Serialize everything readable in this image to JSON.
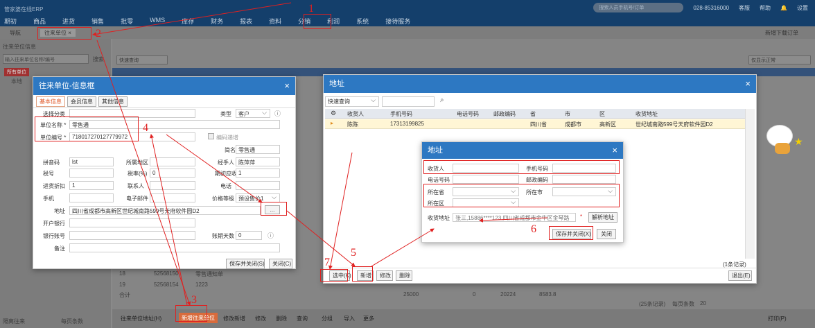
{
  "app": {
    "logo_text": "管家婆在线ERP",
    "phone": "028-85316000",
    "help": "客服",
    "user": "帮助",
    "settings": "设置",
    "search_placeholder": "搜索人员手机号/订单"
  },
  "nav": {
    "items": [
      "期初",
      "商品",
      "进货",
      "销售",
      "批零",
      "WMS",
      "库存",
      "财务",
      "报表",
      "资料",
      "分销",
      "利润",
      "系统",
      "接待服务"
    ]
  },
  "tabs": {
    "nav_label": "导航",
    "active_tab": "往来单位",
    "tab_close": "×",
    "right_link": "新增下载订单"
  },
  "left": {
    "title": "往来单位信息",
    "search_placeholder": "输入往来单位名称/编号",
    "search_btn": "搜索",
    "tree_all": "所有单位",
    "tree_child": "本地"
  },
  "main": {
    "quick_query": "快速查询",
    "bottom_total": "合计",
    "status_right": "仅显示正常",
    "rows": [
      {
        "no": "18",
        "code": "52568150",
        "name": "零售通知单"
      },
      {
        "no": "19",
        "code": "52568154",
        "name": "1223"
      }
    ],
    "totals": [
      "25000",
      "0",
      "20224",
      "8583.8"
    ],
    "paging": "(25条记录)",
    "per_page": "每页条数",
    "page_size": "20"
  },
  "bottom": {
    "buttons": [
      "往来单位地址(H)",
      "新增往来单位",
      "修改新增",
      "修改",
      "删除",
      "查询",
      "分组",
      "导入",
      "更多"
    ],
    "left_label": "隔离往来",
    "left_count": "每页条数",
    "print": "打印(P)"
  },
  "info_dialog": {
    "title": "往来单位-信息框",
    "close": "×",
    "tabs": [
      "基本信息",
      "会员信息",
      "其他信息"
    ],
    "fields": {
      "category_label": "选择分类",
      "type_label": "类型",
      "type_value": "客户",
      "name_label": "单位名称 *",
      "name_value": "零售通",
      "code_label": "单位编号 *",
      "code_value": "718017270127779972",
      "check_label": "编码递增",
      "short_label": "简名",
      "short_value": "零售通",
      "pinyin_label": "拼音码",
      "pinyin_value": "lst",
      "region_label": "所属地区",
      "manager_label": "经手人",
      "manager_value": "陈萍萍",
      "tax_label": "税号",
      "tax_rate_label": "税率(%)",
      "tax_rate_value": "0",
      "receivable_label": "期初应收",
      "receivable_value": "1",
      "advance_label": "进货折扣",
      "advance_value": "1",
      "contact_label": "联系人",
      "phone_label": "电话",
      "mobile_label": "手机",
      "email_label": "电子邮件",
      "price_label": "价格等级",
      "price_value": "预设售价1",
      "address_label": "地址",
      "address_value": "四川省成都市高新区世纪城南路599号天府软件园D2",
      "address_btn": "...",
      "bank_label": "开户银行",
      "account_label": "银行账号",
      "days_label": "账期天数",
      "days_value": "0",
      "note_label": "备注"
    },
    "save_btn": "保存并关闭(S)",
    "close_btn": "关闭(C)"
  },
  "addr_dialog": {
    "title": "地址",
    "close": "×",
    "quick_query": "快速查询",
    "columns": [
      "收货人",
      "手机号码",
      "电话号码",
      "邮政编码",
      "省",
      "市",
      "区",
      "收货地址"
    ],
    "row": {
      "receiver": "陈陈",
      "mobile": "17313199825",
      "phone": "",
      "zip": "",
      "province": "四川省",
      "city": "成都市",
      "district": "高新区",
      "address": "世纪城南路599号天府软件园D2"
    },
    "records": "(1条记录)",
    "btn_select": "选中(K)",
    "btn_add": "新增",
    "btn_edit": "修改",
    "btn_delete": "删除",
    "btn_exit": "退出(E)"
  },
  "addr_form": {
    "title": "地址",
    "close": "×",
    "receiver_label": "收货人",
    "mobile_label": "手机号码",
    "phone_label": "电话号码",
    "zip_label": "邮政编码",
    "province_label": "所在省",
    "city_label": "所在市",
    "district_label": "所在区",
    "address_label": "收货地址",
    "address_value": "张三,15886****123,四川省成都市金牛区金琴路",
    "required_mark": "*",
    "parse_btn": "解析地址",
    "save_btn": "保存并关闭(X)",
    "close_btn": "关闭"
  },
  "annotations": {
    "n1": "1",
    "n2": "2",
    "n3": "3",
    "n4": "4",
    "n5": "5",
    "n6": "6",
    "n7": "7"
  },
  "colors": {
    "topbar": "#143f6b",
    "dialog_title": "#2d78c2",
    "annotation": "#e02020",
    "selected_row": "#fff6d5"
  }
}
